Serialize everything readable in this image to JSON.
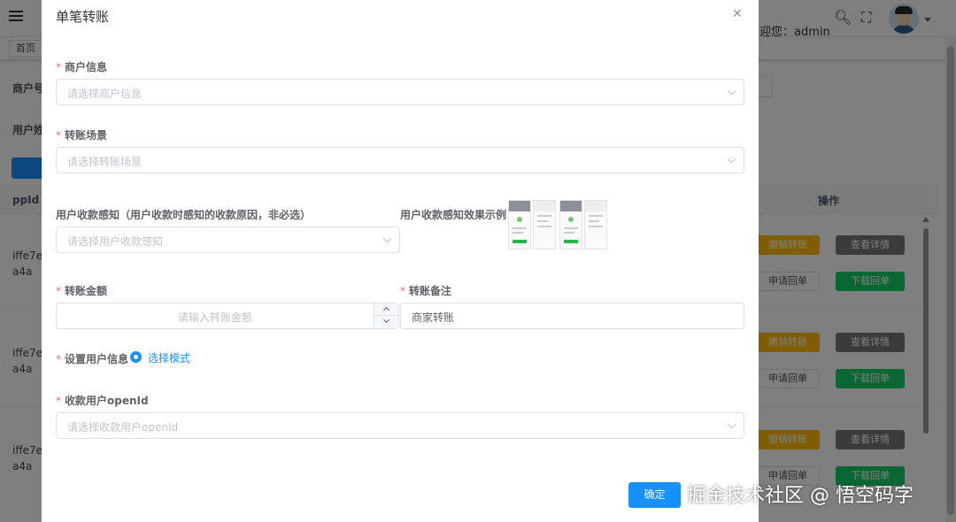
{
  "header": {
    "welcome": "迎您：admin",
    "tag_home": "首页"
  },
  "background": {
    "label_merchant_no": "商户号",
    "label_user_name": "用户姓",
    "col_openid": "ppId",
    "col_operation": "操作",
    "rows": [
      {
        "openid_line1": "iffe7e",
        "openid_line2": "a4a"
      },
      {
        "openid_line1": "iffe7e",
        "openid_line2": "a4a"
      },
      {
        "openid_line1": "iffe7e",
        "openid_line2": "a4a"
      }
    ],
    "btn_revoke": "撤销转账",
    "btn_view": "查看详情",
    "btn_apply_receipt": "申请回单",
    "btn_download_receipt": "下载回单"
  },
  "dialog": {
    "title": "单笔转账",
    "merchant_label": "商户信息",
    "merchant_placeholder": "请选择商户信息",
    "scene_label": "转账场景",
    "scene_placeholder": "请选择转账场景",
    "perception_label": "用户收款感知（用户收款时感知的收款原因，非必选）",
    "perception_placeholder": "请选择用户收款感知",
    "perception_example_label": "用户收款感知效果示例",
    "amount_label": "转账金额",
    "amount_placeholder": "请输入转账金额",
    "remark_label": "转账备注",
    "remark_value": "商家转账",
    "user_info_label": "设置用户信息",
    "user_info_mode": "选择模式",
    "openid_label": "收款用户openId",
    "openid_placeholder": "请选择收款用户openId",
    "confirm": "确定"
  },
  "watermark": "掘金技术社区 @ 悟空码字",
  "colors": {
    "primary": "#1890ff",
    "required": "#f56c6c",
    "warning": "#ffba00",
    "success": "#13ce66"
  }
}
